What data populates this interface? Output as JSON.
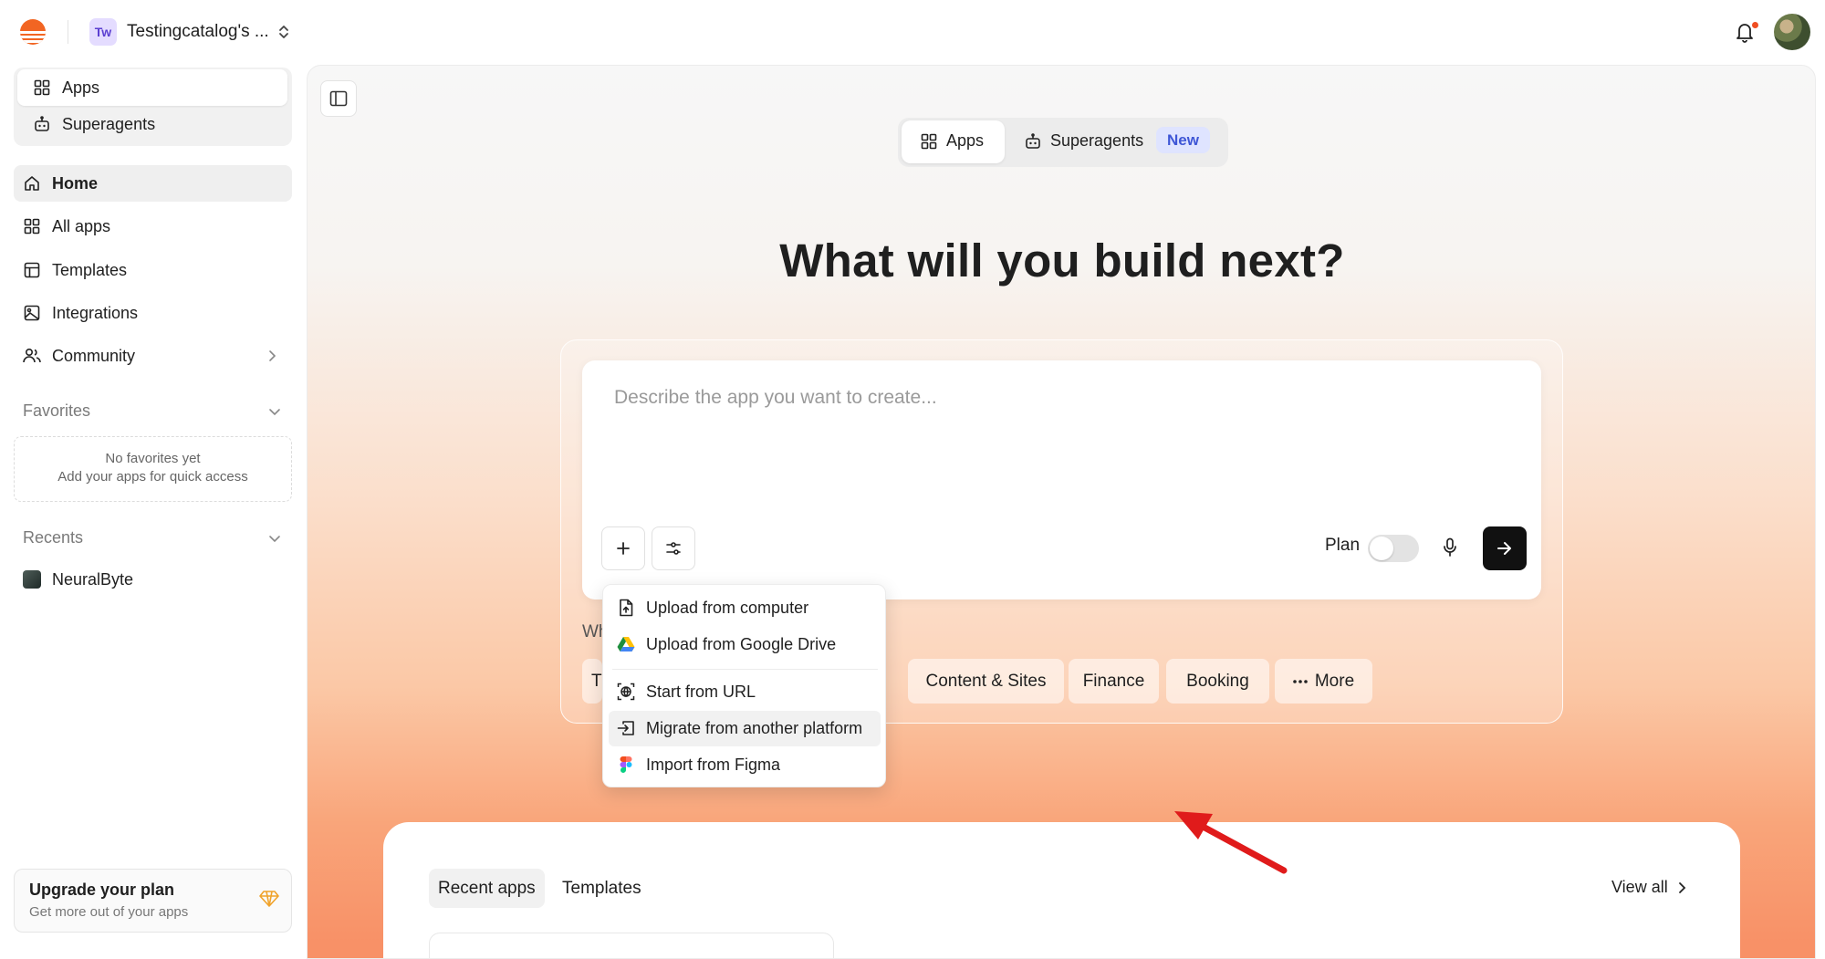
{
  "topbar": {
    "workspace_initials": "Tw",
    "workspace_name": "Testingcatalog's ...",
    "notification_dot_color": "#f04e23"
  },
  "sidebar": {
    "mode_tabs": [
      {
        "label": "Apps",
        "icon": "grid-icon",
        "active": true
      },
      {
        "label": "Superagents",
        "icon": "robot-icon",
        "active": false
      }
    ],
    "nav": [
      {
        "label": "Home",
        "icon": "home-icon",
        "active": true
      },
      {
        "label": "All apps",
        "icon": "grid-icon"
      },
      {
        "label": "Templates",
        "icon": "layout-icon"
      },
      {
        "label": "Integrations",
        "icon": "image-icon"
      },
      {
        "label": "Community",
        "icon": "users-icon",
        "has_chevron": true
      }
    ],
    "favorites": {
      "label": "Favorites",
      "empty_title": "No favorites yet",
      "empty_subtitle": "Add your apps for quick access"
    },
    "recents": {
      "label": "Recents",
      "items": [
        {
          "label": "NeuralByte"
        }
      ]
    },
    "upgrade": {
      "title": "Upgrade your plan",
      "subtitle": "Get more out of your apps",
      "icon": "gem-icon",
      "icon_color": "#f0a32b"
    }
  },
  "main": {
    "mode_tabs": [
      {
        "label": "Apps",
        "icon": "grid-icon",
        "active": true
      },
      {
        "label": "Superagents",
        "icon": "robot-icon",
        "badge": "New"
      }
    ],
    "headline": "What will you build next?",
    "prompt": {
      "placeholder": "Describe the app you want to create...",
      "plan_label": "Plan",
      "plan_enabled": false
    },
    "attach_menu": {
      "items": [
        {
          "label": "Upload from computer",
          "icon": "file-upload-icon"
        },
        {
          "label": "Upload from Google Drive",
          "icon": "google-drive-icon"
        },
        {
          "label": "Start from URL",
          "icon": "globe-scan-icon"
        },
        {
          "label": "Migrate from another platform",
          "icon": "migrate-icon",
          "highlighted": true
        },
        {
          "label": "Import from Figma",
          "icon": "figma-icon"
        }
      ]
    },
    "suggestions_label_partial": "Wh",
    "chips": [
      {
        "label": "T"
      },
      {
        "label": "Content & Sites"
      },
      {
        "label": "Finance"
      },
      {
        "label": "Booking"
      },
      {
        "label": "More",
        "icon": "dots-icon"
      }
    ],
    "recent_section": {
      "tabs": [
        {
          "label": "Recent apps",
          "active": true
        },
        {
          "label": "Templates"
        }
      ],
      "view_all": "View all"
    },
    "annotation_arrow_color": "#e01b1b"
  }
}
